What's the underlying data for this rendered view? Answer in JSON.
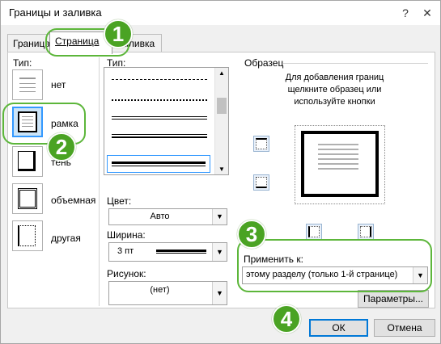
{
  "window": {
    "title": "Границы и заливка",
    "help": "?",
    "close": "✕"
  },
  "tabs": [
    {
      "label": "Граница"
    },
    {
      "label": "Страница"
    },
    {
      "label": "Заливка"
    }
  ],
  "setting": {
    "label": "Тип:",
    "items": [
      {
        "label": "нет"
      },
      {
        "label": "рамка"
      },
      {
        "label": "тень"
      },
      {
        "label": "объемная"
      },
      {
        "label": "другая"
      }
    ]
  },
  "style": {
    "label": "Тип:"
  },
  "color": {
    "label": "Цвет:",
    "value": "Авто"
  },
  "width": {
    "label": "Ширина:",
    "value": "3 пт"
  },
  "art": {
    "label": "Рисунок:",
    "value": "(нет)"
  },
  "preview": {
    "label": "Образец",
    "hint": "Для добавления границ щелкните образец или используйте кнопки"
  },
  "apply_to": {
    "label": "Применить к:",
    "value": "этому разделу (только 1-й странице)"
  },
  "buttons": {
    "options": "Параметры...",
    "ok": "ОК",
    "cancel": "Отмена"
  },
  "callouts": [
    "1",
    "2",
    "3",
    "4"
  ],
  "colors": {
    "callout": "#4aa323",
    "ok_border": "#0078d7"
  }
}
